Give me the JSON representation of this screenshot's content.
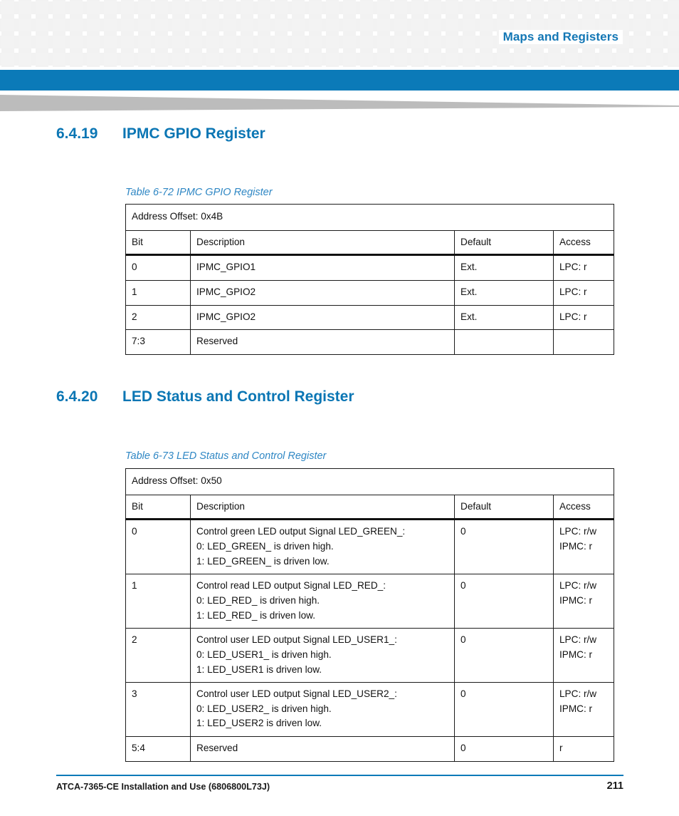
{
  "header": {
    "title": "Maps and Registers"
  },
  "sections": [
    {
      "number": "6.4.19",
      "title": "IPMC GPIO Register",
      "caption": "Table 6-72 IPMC GPIO Register",
      "table": {
        "address_offset": "Address Offset: 0x4B",
        "columns": [
          "Bit",
          "Description",
          "Default",
          "Access"
        ],
        "rows": [
          {
            "bit": "0",
            "description": [
              "IPMC_GPIO1"
            ],
            "default": "Ext.",
            "access": [
              "LPC: r"
            ]
          },
          {
            "bit": "1",
            "description": [
              "IPMC_GPIO2"
            ],
            "default": "Ext.",
            "access": [
              "LPC: r"
            ]
          },
          {
            "bit": "2",
            "description": [
              "IPMC_GPIO2"
            ],
            "default": "Ext.",
            "access": [
              "LPC: r"
            ]
          },
          {
            "bit": "7:3",
            "description": [
              "Reserved"
            ],
            "default": "",
            "access": [
              ""
            ]
          }
        ]
      }
    },
    {
      "number": "6.4.20",
      "title": "LED Status and Control Register",
      "caption": "Table 6-73 LED Status and Control Register",
      "table": {
        "address_offset": "Address Offset: 0x50",
        "columns": [
          "Bit",
          "Description",
          "Default",
          "Access"
        ],
        "rows": [
          {
            "bit": "0",
            "description": [
              "Control green LED output Signal LED_GREEN_:",
              "0: LED_GREEN_ is driven high.",
              "1: LED_GREEN_ is driven low."
            ],
            "default": "0",
            "access": [
              "LPC: r/w",
              "IPMC: r"
            ]
          },
          {
            "bit": "1",
            "description": [
              "Control read LED output Signal LED_RED_:",
              "0: LED_RED_ is driven high.",
              "1: LED_RED_ is driven low."
            ],
            "default": "0",
            "access": [
              "LPC: r/w",
              "IPMC: r"
            ]
          },
          {
            "bit": "2",
            "description": [
              "Control user LED output Signal LED_USER1_:",
              "0: LED_USER1_ is driven high.",
              "1: LED_USER1 is driven low."
            ],
            "default": "0",
            "access": [
              "LPC: r/w",
              "IPMC: r"
            ]
          },
          {
            "bit": "3",
            "description": [
              "Control user LED output Signal LED_USER2_:",
              "0: LED_USER2_ is driven high.",
              "1: LED_USER2 is driven low."
            ],
            "default": "0",
            "access": [
              "LPC: r/w",
              "IPMC: r"
            ]
          },
          {
            "bit": "5:4",
            "description": [
              "Reserved"
            ],
            "default": "0",
            "access": [
              "r"
            ]
          }
        ]
      }
    }
  ],
  "footer": {
    "document": "ATCA-7365-CE Installation and Use (6806800L73J)",
    "page_number": "211"
  },
  "colors": {
    "accent_blue": "#0b7ab8",
    "heading_blue": "#0b76b4",
    "caption_blue": "#2f87c4",
    "swoosh_gray": "#bcbcbc",
    "check_gray": "#f3f3f3"
  }
}
